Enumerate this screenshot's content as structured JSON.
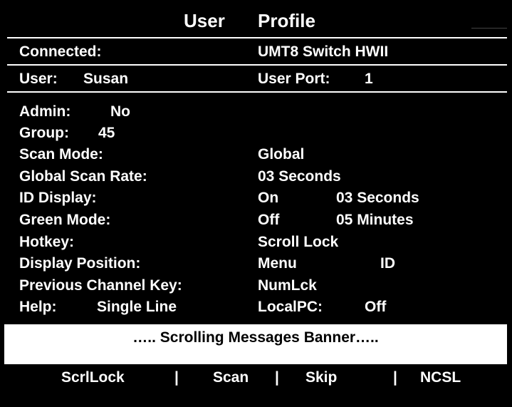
{
  "title": {
    "word1": "User",
    "word2": "Profile"
  },
  "connected": {
    "label": "Connected:",
    "value": "UMT8 Switch HWII"
  },
  "user": {
    "label": "User:",
    "name": "Susan",
    "port_label": "User Port:",
    "port_value": "1"
  },
  "admin": {
    "label": "Admin:",
    "value": "No"
  },
  "group": {
    "label": "Group:",
    "value": "45"
  },
  "scan_mode": {
    "label": "Scan Mode:",
    "value": "Global"
  },
  "global_scan_rate": {
    "label": "Global Scan Rate:",
    "value": "03  Seconds"
  },
  "id_display": {
    "label": "ID Display:",
    "state": "On",
    "time": "03  Seconds"
  },
  "green_mode": {
    "label": "Green Mode:",
    "state": "Off",
    "time": "05  Minutes"
  },
  "hotkey": {
    "label": "Hotkey:",
    "value": "Scroll Lock"
  },
  "display_position": {
    "label": "Display Position:",
    "value1": "Menu",
    "value2": "ID"
  },
  "previous_channel_key": {
    "label": "Previous Channel Key:",
    "value": "NumLck"
  },
  "help": {
    "label": "Help:",
    "value": "Single Line",
    "localpc_label": "LocalPC:",
    "localpc_value": "Off"
  },
  "banner": {
    "text": "….. Scrolling Messages Banner….."
  },
  "function_keys": {
    "scrllock": "ScrlLock",
    "scan": "Scan",
    "skip": "Skip",
    "ncsl": "NCSL",
    "separator": "|"
  },
  "colors": {
    "background": "#000000",
    "text": "#ffffff",
    "banner_bg": "#ffffff",
    "banner_text": "#000000"
  }
}
